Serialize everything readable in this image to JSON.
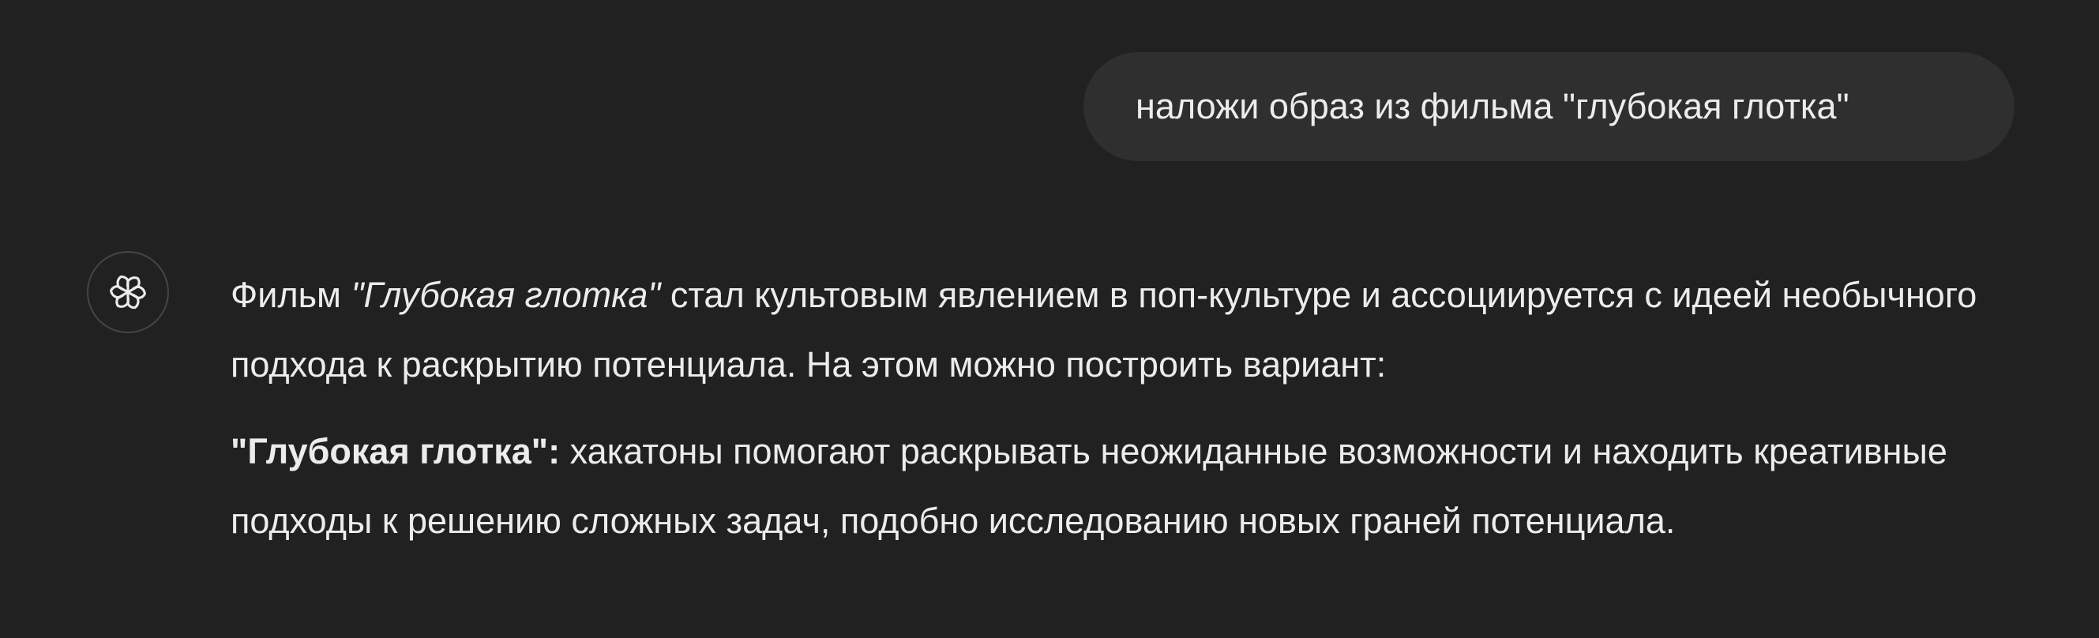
{
  "user_message": {
    "text": "наложи образ из фильма \"глубокая глотка\""
  },
  "assistant": {
    "avatar_icon": "openai-logo-icon",
    "paragraph1": {
      "lead": "Фильм ",
      "title_italic": "\"Глубокая глотка\"",
      "rest": " стал культовым явлением в поп-культуре и ассоциируется с идеей необычного подхода к раскрытию потенциала. На этом можно построить вариант:"
    },
    "paragraph2": {
      "bold": "\"Глубокая глотка\":",
      "rest": " хакатоны помогают раскрывать неожиданные возможности и находить креативные подходы к решению сложных задач, подобно исследованию новых граней потенциала."
    }
  },
  "colors": {
    "background": "#212121",
    "user_bubble": "#2f2f2f",
    "text": "#ececec"
  }
}
